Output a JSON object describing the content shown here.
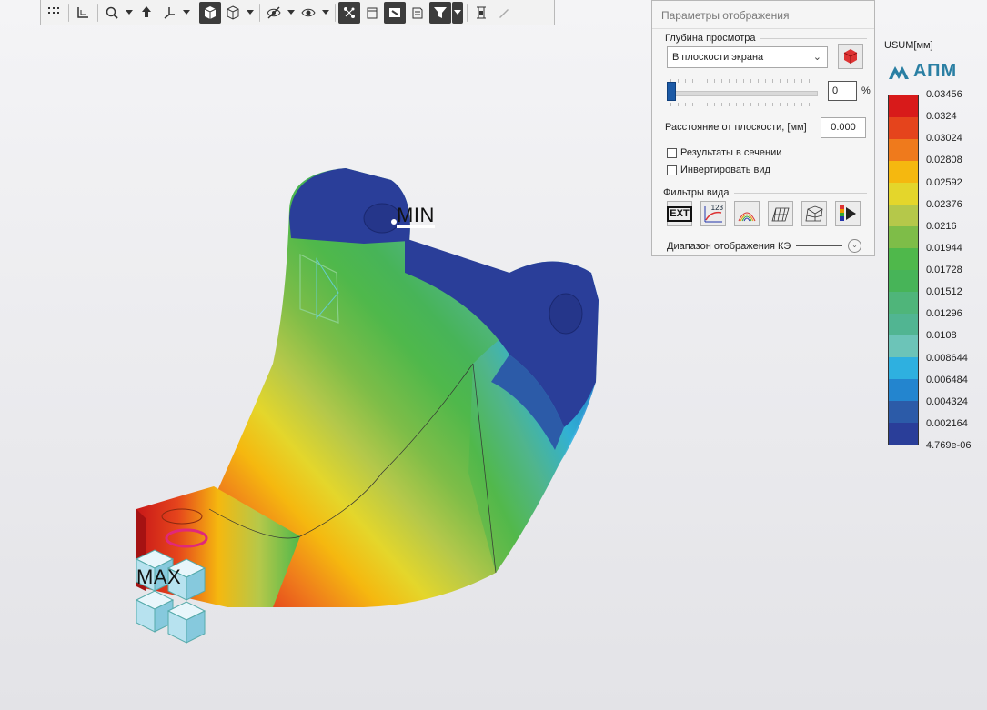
{
  "toolbar": {
    "buttons": [
      "grid-icon",
      "axes-icon",
      "zoom-icon",
      "dropdown",
      "orient-icon",
      "coord-icon",
      "dropdown",
      "shaded-cube-icon",
      "wire-cube-icon",
      "dropdown",
      "hide-icon",
      "dropdown",
      "show-icon",
      "dropdown",
      "mesh-nodes-icon",
      "section-icon",
      "display-mode-icon",
      "layers-icon",
      "filter-icon",
      "dropdown",
      "measure-icon",
      "probe-icon"
    ]
  },
  "viewport": {
    "label_min": "MIN",
    "label_max": "MAX"
  },
  "panel": {
    "title": "Параметры отображения",
    "depth_section": "Глубина просмотра",
    "depth_mode": "В плоскости экрана",
    "depth_percent": "0",
    "depth_percent_unit": "%",
    "depth_slider_fraction": 0,
    "distance_label": "Расстояние от плоскости, [мм]",
    "distance_value": "0.000",
    "checkbox_section_results": "Результаты в сечении",
    "checkbox_invert": "Инвертировать вид",
    "filters_section": "Фильтры вида",
    "filter_ext": "EXT",
    "filter_num": "123",
    "range_label": "Диапазон отображения КЭ"
  },
  "legend": {
    "title": "USUM[мм]",
    "logo": "АПМ",
    "levels": [
      "0.03456",
      "0.0324",
      "0.03024",
      "0.02808",
      "0.02592",
      "0.02376",
      "0.0216",
      "0.01944",
      "0.01728",
      "0.01512",
      "0.01296",
      "0.0108",
      "0.008644",
      "0.006484",
      "0.004324",
      "0.002164",
      "4.769e-06"
    ],
    "colors": [
      "#d81a1a",
      "#e5441c",
      "#ef7a1c",
      "#f5b80f",
      "#e4d62b",
      "#b5c84a",
      "#7ebd48",
      "#4fb84b",
      "#47b458",
      "#4fb57a",
      "#51b592",
      "#6cc4b8",
      "#2eb0e0",
      "#2385cf",
      "#2c5ba8",
      "#2a3e99"
    ]
  },
  "colors": {
    "accent": "#1c5aa6",
    "logo": "#2a7fa3"
  }
}
